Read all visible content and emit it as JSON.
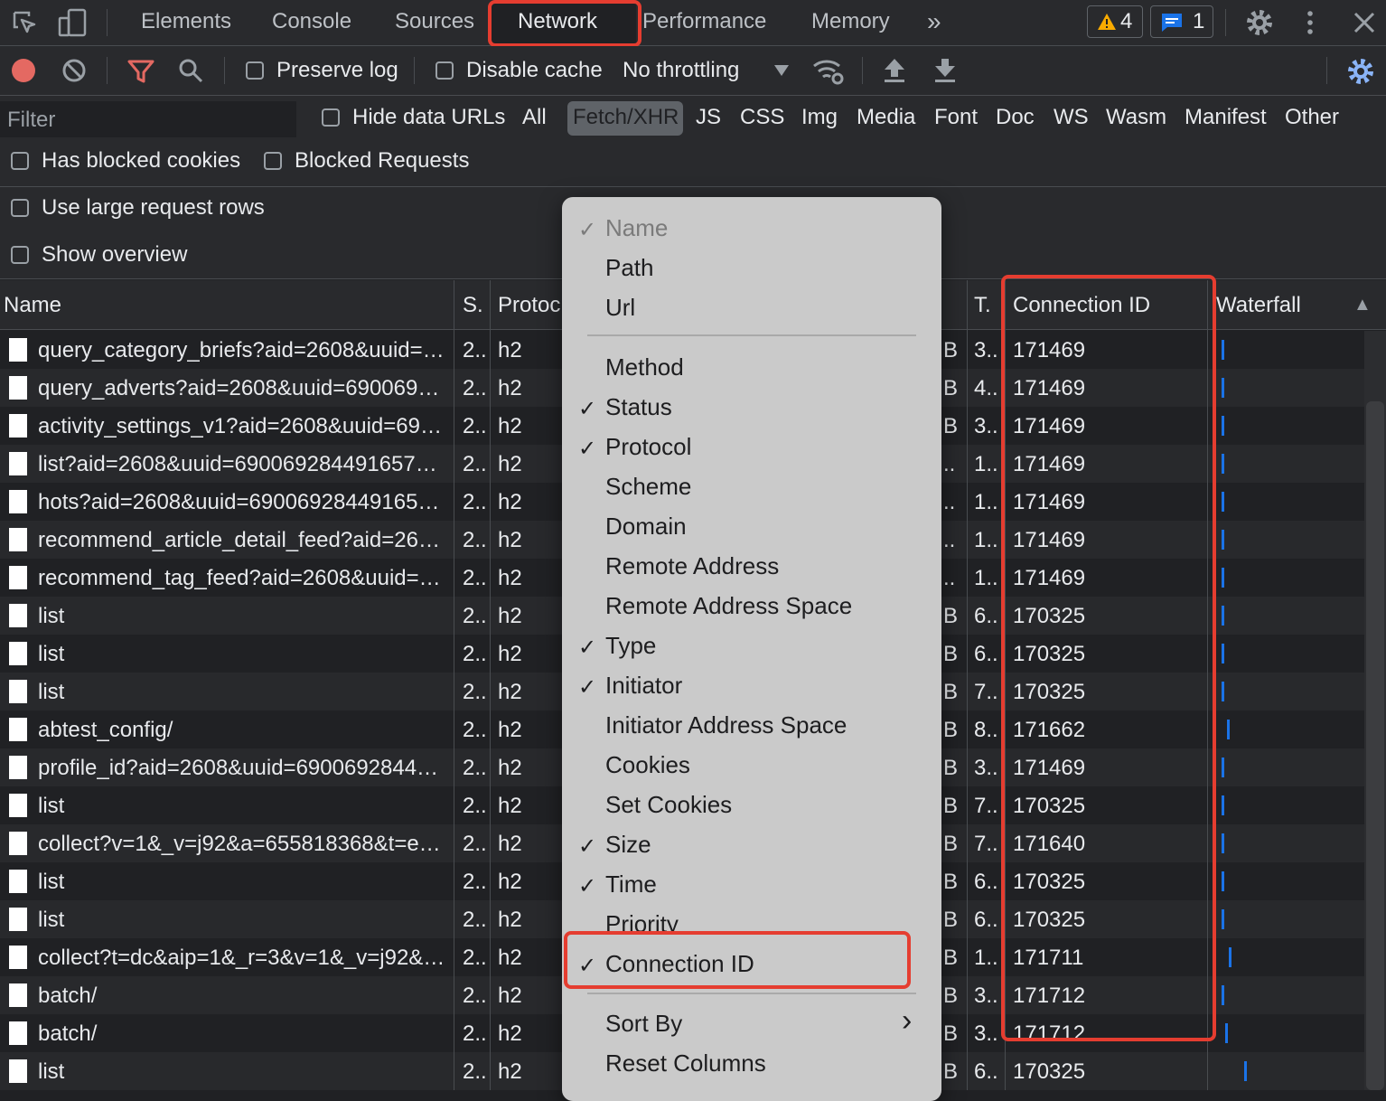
{
  "tabs": [
    {
      "label": "Elements"
    },
    {
      "label": "Console"
    },
    {
      "label": "Sources"
    },
    {
      "label": "Network"
    },
    {
      "label": "Performance"
    },
    {
      "label": "Memory"
    }
  ],
  "more_tabs": "»",
  "warnings_count": "4",
  "messages_count": "1",
  "toolbar": {
    "preserve_log": "Preserve log",
    "disable_cache": "Disable cache",
    "throttling": "No throttling"
  },
  "filter": {
    "placeholder": "Filter",
    "hide_data_urls": "Hide data URLs",
    "types": [
      "All",
      "Fetch/XHR",
      "JS",
      "CSS",
      "Img",
      "Media",
      "Font",
      "Doc",
      "WS",
      "Wasm",
      "Manifest",
      "Other"
    ],
    "selected_type": "Fetch/XHR",
    "has_blocked_cookies": "Has blocked cookies",
    "blocked_requests": "Blocked Requests",
    "use_large_rows": "Use large request rows",
    "show_overview": "Show overview"
  },
  "columns": {
    "name": "Name",
    "status": "S.",
    "protocol": "Protoc",
    "time": "T.",
    "connection_id": "Connection ID",
    "waterfall": "Waterfall",
    "sort_arrow": "▲"
  },
  "rows": [
    {
      "name": "query_category_briefs?aid=2608&uuid=…",
      "status": "2..",
      "protocol": "h2",
      "size": "B",
      "time": "3..",
      "conn": "171469"
    },
    {
      "name": "query_adverts?aid=2608&uuid=690069…",
      "status": "2..",
      "protocol": "h2",
      "size": "B",
      "time": "4..",
      "conn": "171469"
    },
    {
      "name": "activity_settings_v1?aid=2608&uuid=69…",
      "status": "2..",
      "protocol": "h2",
      "size": "B",
      "time": "3..",
      "conn": "171469"
    },
    {
      "name": "list?aid=2608&uuid=690069284491657…",
      "status": "2..",
      "protocol": "h2",
      "size": "..",
      "time": "1..",
      "conn": "171469"
    },
    {
      "name": "hots?aid=2608&uuid=69006928449165…",
      "status": "2..",
      "protocol": "h2",
      "size": "..",
      "time": "1..",
      "conn": "171469"
    },
    {
      "name": "recommend_article_detail_feed?aid=26…",
      "status": "2..",
      "protocol": "h2",
      "size": "..",
      "time": "1..",
      "conn": "171469"
    },
    {
      "name": "recommend_tag_feed?aid=2608&uuid=…",
      "status": "2..",
      "protocol": "h2",
      "size": "..",
      "time": "1..",
      "conn": "171469"
    },
    {
      "name": "list",
      "status": "2..",
      "protocol": "h2",
      "size": "B",
      "time": "6..",
      "conn": "170325"
    },
    {
      "name": "list",
      "status": "2..",
      "protocol": "h2",
      "size": "B",
      "time": "6..",
      "conn": "170325"
    },
    {
      "name": "list",
      "status": "2..",
      "protocol": "h2",
      "size": "B",
      "time": "7..",
      "conn": "170325"
    },
    {
      "name": "abtest_config/",
      "status": "2..",
      "protocol": "h2",
      "size": "B",
      "time": "8..",
      "conn": "171662"
    },
    {
      "name": "profile_id?aid=2608&uuid=6900692844…",
      "status": "2..",
      "protocol": "h2",
      "size": "B",
      "time": "3..",
      "conn": "171469"
    },
    {
      "name": "list",
      "status": "2..",
      "protocol": "h2",
      "size": "B",
      "time": "7..",
      "conn": "170325"
    },
    {
      "name": "collect?v=1&_v=j92&a=655818368&t=e…",
      "status": "2..",
      "protocol": "h2",
      "size": "B",
      "time": "7..",
      "conn": "171640"
    },
    {
      "name": "list",
      "status": "2..",
      "protocol": "h2",
      "size": "B",
      "time": "6..",
      "conn": "170325"
    },
    {
      "name": "list",
      "status": "2..",
      "protocol": "h2",
      "size": "B",
      "time": "6..",
      "conn": "170325"
    },
    {
      "name": "collect?t=dc&aip=1&_r=3&v=1&_v=j92&…",
      "status": "2..",
      "protocol": "h2",
      "size": "B",
      "time": "1..",
      "conn": "171711"
    },
    {
      "name": "batch/",
      "status": "2..",
      "protocol": "h2",
      "size": "B",
      "time": "3..",
      "conn": "171712"
    },
    {
      "name": "batch/",
      "status": "2..",
      "protocol": "h2",
      "size": "B",
      "time": "3..",
      "conn": "171712"
    },
    {
      "name": "list",
      "status": "2..",
      "protocol": "h2",
      "size": "B",
      "time": "6..",
      "conn": "170325"
    }
  ],
  "context_menu": {
    "items": [
      {
        "label": "Name",
        "checked": true,
        "disabled": true
      },
      {
        "label": "Path",
        "checked": false
      },
      {
        "label": "Url",
        "checked": false
      },
      {
        "label": "Method",
        "checked": false
      },
      {
        "label": "Status",
        "checked": true
      },
      {
        "label": "Protocol",
        "checked": true
      },
      {
        "label": "Scheme",
        "checked": false
      },
      {
        "label": "Domain",
        "checked": false
      },
      {
        "label": "Remote Address",
        "checked": false
      },
      {
        "label": "Remote Address Space",
        "checked": false
      },
      {
        "label": "Type",
        "checked": true
      },
      {
        "label": "Initiator",
        "checked": true
      },
      {
        "label": "Initiator Address Space",
        "checked": false
      },
      {
        "label": "Cookies",
        "checked": false
      },
      {
        "label": "Set Cookies",
        "checked": false
      },
      {
        "label": "Size",
        "checked": true
      },
      {
        "label": "Time",
        "checked": true
      },
      {
        "label": "Priority",
        "checked": false
      },
      {
        "label": "Connection ID",
        "checked": true
      },
      {
        "label": "Sort By",
        "submenu": true
      },
      {
        "label": "Reset Columns",
        "checked": false
      }
    ],
    "check_glyph": "✓",
    "submenu_glyph": "›"
  },
  "colors": {
    "highlight": "#e53d30",
    "accent": "#1a73e8",
    "record": "#e46962"
  }
}
